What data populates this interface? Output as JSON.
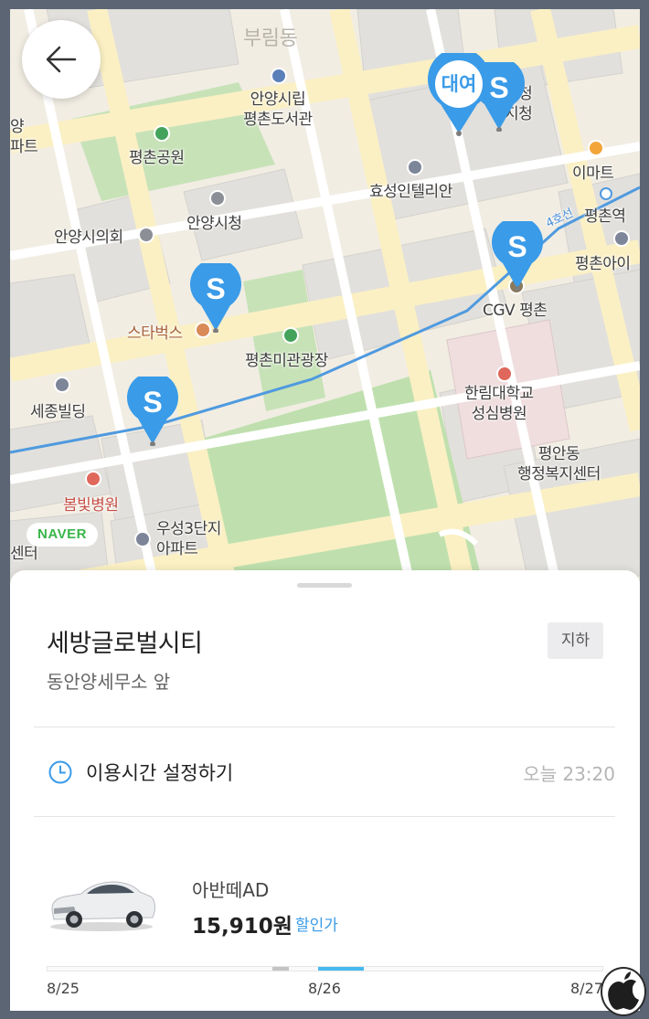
{
  "map": {
    "labels": {
      "district": "부림동",
      "library": "안양시립\n평촌도서관",
      "park": "평촌공원",
      "council": "안양시의회",
      "city_hall": "안양시청",
      "starbucks": "스타벅스",
      "plaza": "평촌미관광장",
      "sejong": "세종빌딩",
      "bombit": "봄빛병원",
      "woosung": "우성3단지\n아파트",
      "hyosung": "효성인텔리안",
      "emart": "이마트",
      "station": "평촌역",
      "apt_right": "평촌아이",
      "cgv": "CGV 평촌",
      "hallym": "한림대학교\n성심병원",
      "pyeongan": "평안동\n행정복지센터",
      "police": "찰청\n지청",
      "line": "4호선",
      "edge_left_top": "양\n파트",
      "edge_left_bottom": "센터"
    },
    "pins": [
      {
        "id": "rent",
        "label": "대여",
        "color": "#ffffff"
      },
      {
        "id": "s1",
        "label": "S",
        "color": "#3a9be8"
      },
      {
        "id": "s2",
        "label": "S",
        "color": "#3a9be8"
      },
      {
        "id": "s3",
        "label": "S",
        "color": "#3a9be8"
      },
      {
        "id": "s4",
        "label": "S",
        "color": "#3a9be8"
      }
    ],
    "brand": "NAVER"
  },
  "sheet": {
    "place_name": "세방글로벌시티",
    "place_sub": "동안양세무소 앞",
    "tag": "지하",
    "time_label": "이용시간 설정하기",
    "time_value": "오늘 23:20",
    "car": {
      "name": "아반떼AD",
      "price": "15,910원",
      "discount_label": "할인가"
    },
    "dates": [
      "8/25",
      "8/26",
      "8/27"
    ]
  },
  "colors": {
    "accent": "#3a9be8",
    "timeline_active": "#47b9f0"
  }
}
